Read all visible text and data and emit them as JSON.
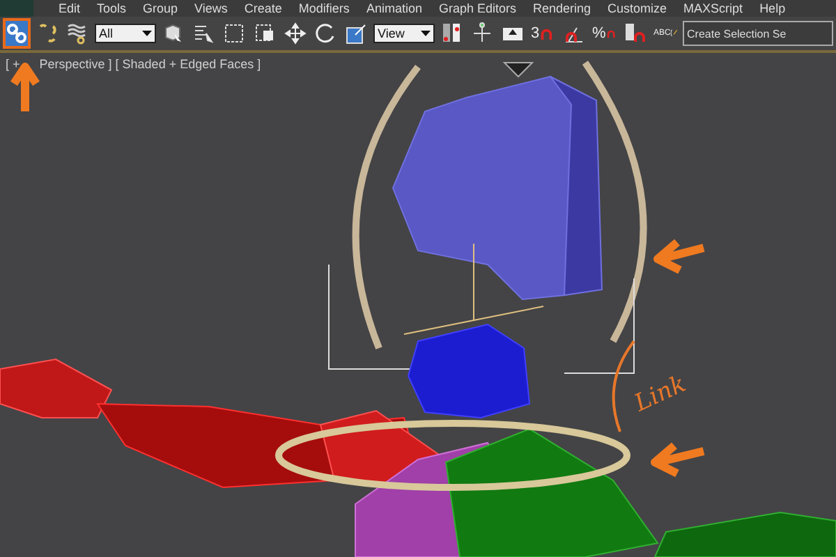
{
  "menu": [
    "Edit",
    "Tools",
    "Group",
    "Views",
    "Create",
    "Modifiers",
    "Animation",
    "Graph Editors",
    "Rendering",
    "Customize",
    "MAXScript",
    "Help"
  ],
  "toolbar": {
    "items": [
      {
        "kind": "tool",
        "selected": true
      },
      {
        "kind": "tool",
        "selected": false
      },
      {
        "kind": "tool",
        "selected": false
      },
      {
        "kind": "dropdown",
        "value": "All"
      },
      {
        "kind": "tool",
        "selected": false
      },
      {
        "kind": "tool",
        "selected": false
      },
      {
        "kind": "tool",
        "selected": false
      },
      {
        "kind": "tool",
        "selected": false
      },
      {
        "kind": "tool",
        "selected": false
      },
      {
        "kind": "tool",
        "selected": false
      },
      {
        "kind": "tool",
        "selected": false
      },
      {
        "kind": "dropdown",
        "value": "View"
      },
      {
        "kind": "tool",
        "selected": false
      },
      {
        "kind": "tool",
        "selected": false
      },
      {
        "kind": "tool",
        "selected": false
      },
      {
        "kind": "tool",
        "selected": false,
        "label": "3"
      },
      {
        "kind": "tool",
        "selected": false
      },
      {
        "kind": "tool",
        "selected": false,
        "label": "%"
      },
      {
        "kind": "tool",
        "selected": false
      },
      {
        "kind": "tool",
        "selected": false,
        "label": "ABC"
      },
      {
        "kind": "field",
        "value": "Create Selection Se"
      }
    ]
  },
  "viewport": {
    "label_start": "[ +",
    "label_rest": "Perspective ] [ Shaded + Edged Faces ]",
    "annotation": "Link"
  }
}
